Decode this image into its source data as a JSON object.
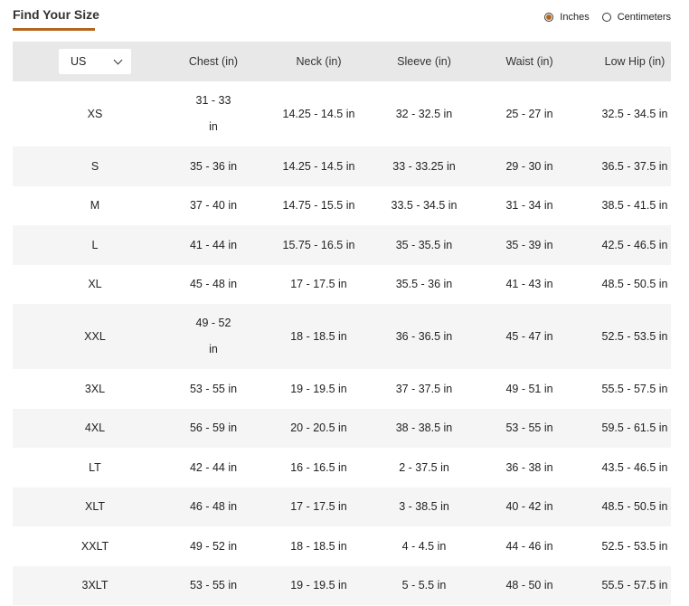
{
  "header": {
    "title": "Find Your Size"
  },
  "units": {
    "options": [
      {
        "label": "Inches",
        "selected": true
      },
      {
        "label": "Centimeters",
        "selected": false
      }
    ],
    "accent_color": "#b5651d"
  },
  "table": {
    "size_system_select": {
      "value": "US"
    },
    "columns": [
      "Chest (in)",
      "Neck (in)",
      "Sleeve (in)",
      "Waist (in)",
      "Low Hip (in)"
    ],
    "rows": [
      {
        "size": "XS",
        "chest_a": "31 - 33",
        "chest_b": "in",
        "neck": "14.25 - 14.5 in",
        "sleeve": "32 - 32.5 in",
        "waist": "25 - 27 in",
        "hip": "32.5 - 34.5 in"
      },
      {
        "size": "S",
        "chest": "35 - 36 in",
        "neck": "14.25 - 14.5 in",
        "sleeve": "33 - 33.25 in",
        "waist": "29 - 30 in",
        "hip": "36.5 - 37.5 in"
      },
      {
        "size": "M",
        "chest": "37 - 40 in",
        "neck": "14.75 - 15.5 in",
        "sleeve": "33.5 - 34.5 in",
        "waist": "31 - 34 in",
        "hip": "38.5 - 41.5 in"
      },
      {
        "size": "L",
        "chest": "41 - 44 in",
        "neck": "15.75 - 16.5 in",
        "sleeve": "35 - 35.5 in",
        "waist": "35 - 39 in",
        "hip": "42.5 - 46.5 in"
      },
      {
        "size": "XL",
        "chest": "45 - 48 in",
        "neck": "17 - 17.5 in",
        "sleeve": "35.5 - 36 in",
        "waist": "41 - 43 in",
        "hip": "48.5 - 50.5 in"
      },
      {
        "size": "XXL",
        "chest_a": "49 - 52",
        "chest_b": "in",
        "neck": "18 - 18.5 in",
        "sleeve": "36 - 36.5 in",
        "waist": "45 - 47 in",
        "hip": "52.5 - 53.5 in"
      },
      {
        "size": "3XL",
        "chest": "53 - 55 in",
        "neck": "19 - 19.5 in",
        "sleeve": "37 - 37.5 in",
        "waist": "49 - 51 in",
        "hip": "55.5 - 57.5 in"
      },
      {
        "size": "4XL",
        "chest": "56 - 59 in",
        "neck": "20 - 20.5 in",
        "sleeve": "38 - 38.5 in",
        "waist": "53 - 55 in",
        "hip": "59.5 - 61.5 in"
      },
      {
        "size": "LT",
        "chest": "42 - 44 in",
        "neck": "16 - 16.5 in",
        "sleeve": "2 - 37.5 in",
        "waist": "36 - 38 in",
        "hip": "43.5 - 46.5 in"
      },
      {
        "size": "XLT",
        "chest": "46 - 48 in",
        "neck": "17 - 17.5 in",
        "sleeve": "3 - 38.5 in",
        "waist": "40 - 42 in",
        "hip": "48.5 - 50.5 in"
      },
      {
        "size": "XXLT",
        "chest": "49 - 52 in",
        "neck": "18 - 18.5 in",
        "sleeve": "4 - 4.5 in",
        "waist": "44 - 46 in",
        "hip": "52.5 - 53.5 in"
      },
      {
        "size": "3XLT",
        "chest": "53 - 55 in",
        "neck": "19 - 19.5 in",
        "sleeve": "5 - 5.5 in",
        "waist": "48 - 50 in",
        "hip": "55.5 - 57.5 in"
      }
    ]
  }
}
